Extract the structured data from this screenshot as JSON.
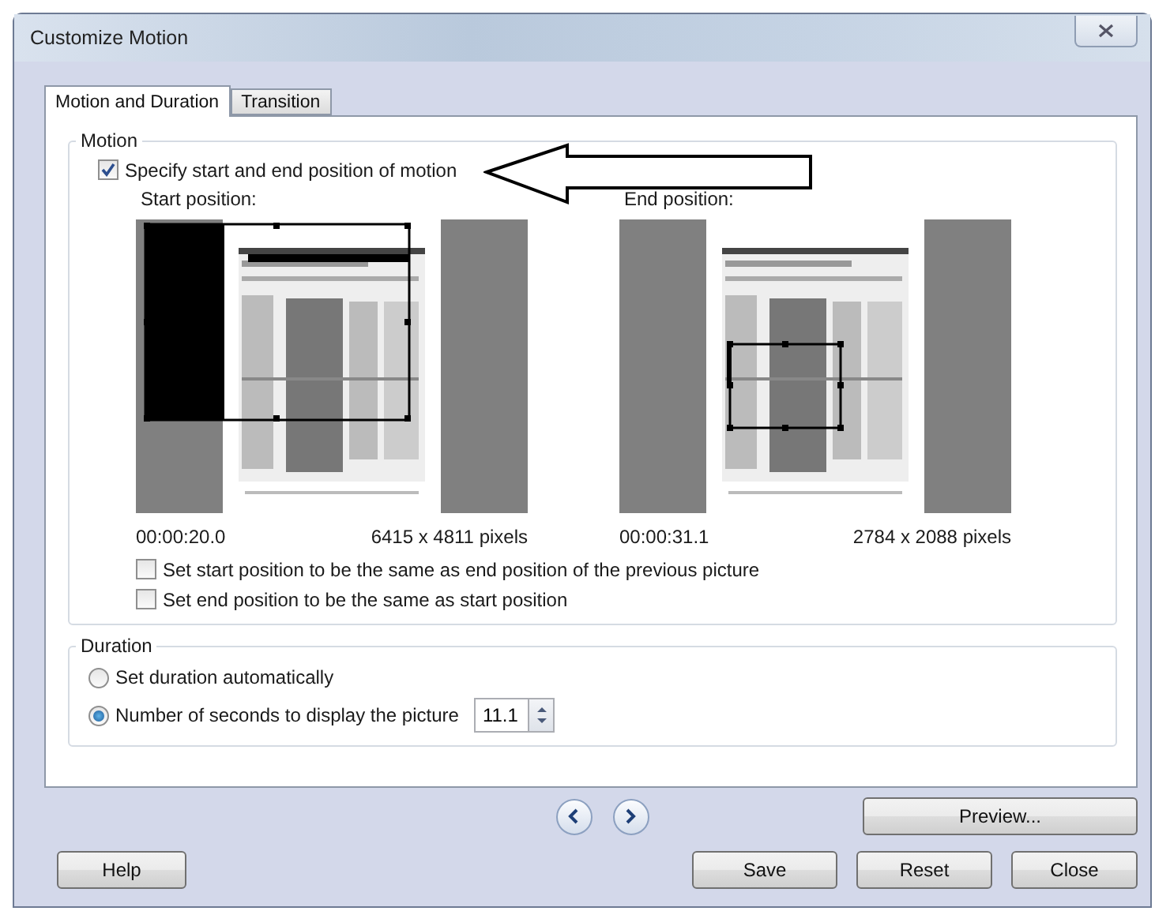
{
  "window": {
    "title": "Customize Motion"
  },
  "tabs": [
    {
      "label": "Motion and Duration",
      "selected": true
    },
    {
      "label": "Transition",
      "selected": false
    }
  ],
  "motion": {
    "title": "Motion",
    "specify": {
      "label": "Specify start and end position of motion",
      "checked": true
    },
    "previews": [
      {
        "label": "Start position:",
        "time": "00:00:20.0",
        "size": "6415 x 4811 pixels"
      },
      {
        "label": "End position:",
        "time": "00:00:31.1",
        "size": "2784 x 2088 pixels"
      }
    ],
    "options": [
      {
        "label": "Set start position to be the same as end position of the previous picture",
        "checked": false
      },
      {
        "label": "Set end position to be the same as start position",
        "checked": false
      }
    ]
  },
  "duration": {
    "title": "Duration",
    "options": [
      {
        "label": "Set duration automatically",
        "selected": false
      },
      {
        "label": "Number of seconds to display the picture",
        "selected": true
      }
    ],
    "seconds": "11.1"
  },
  "buttons": {
    "preview": "Preview...",
    "help": "Help",
    "save": "Save",
    "reset": "Reset",
    "close": "Close"
  }
}
